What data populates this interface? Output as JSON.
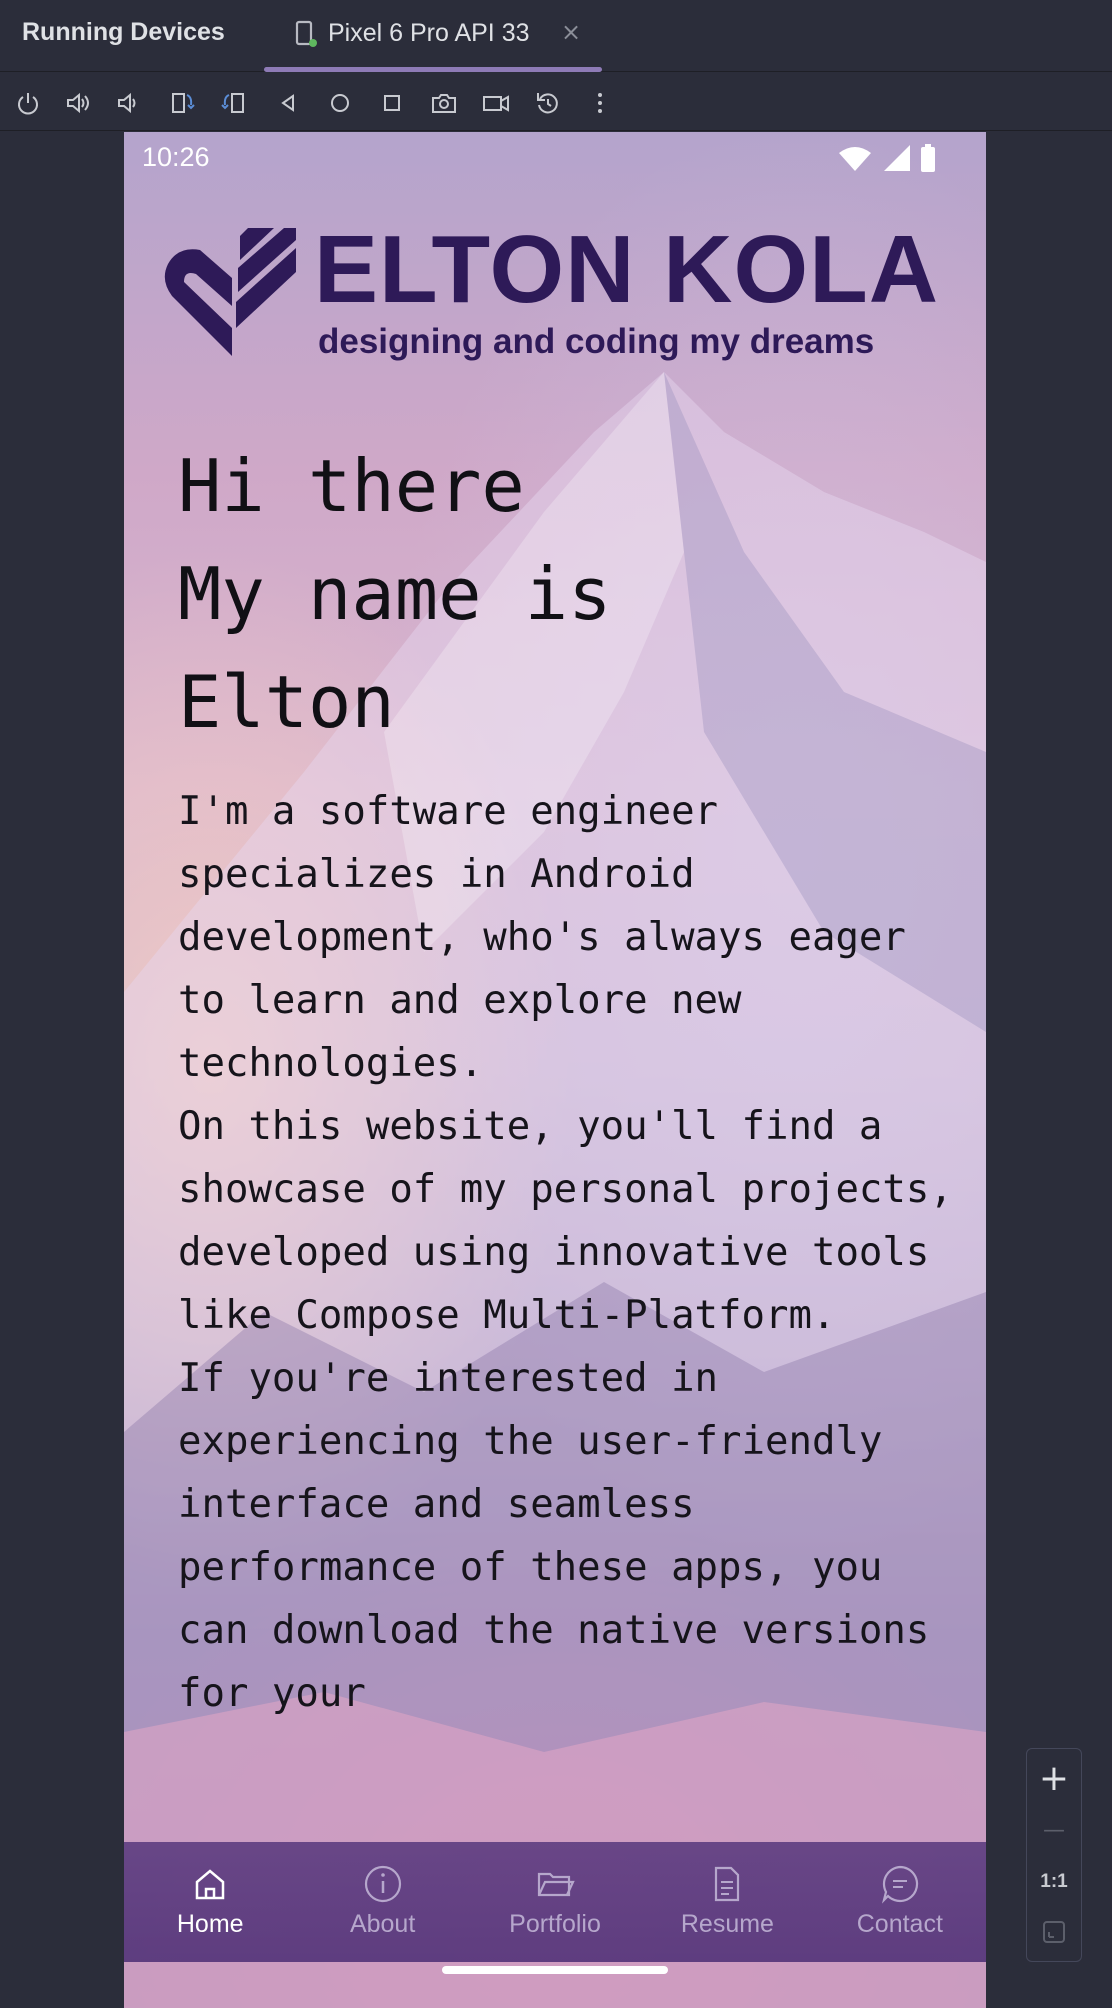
{
  "window": {
    "panel_title": "Running Devices",
    "tab_label": "Pixel 6 Pro API 33",
    "tab_close": "×"
  },
  "toolbar": {
    "buttons": [
      "power-icon",
      "volume-up-icon",
      "volume-down-icon",
      "rotate-left-icon",
      "rotate-right-icon",
      "back-icon",
      "home-icon",
      "overview-icon",
      "screenshot-icon",
      "screen-record-icon",
      "reset-icon",
      "more-icon"
    ]
  },
  "device": {
    "status_time": "10:26",
    "logo": {
      "name": "ELTON KOLA",
      "tagline": "designing and coding my dreams",
      "color": "#2e1a58"
    },
    "hero_lines": [
      "Hi there",
      "My name is",
      "Elton"
    ],
    "intro_paragraphs": [
      "I'm a software engineer specializes in Android development, who's always eager to learn and explore new technologies.",
      "On this website, you'll find a showcase of my personal projects, developed using innovative tools like Compose Multi-Platform.",
      "If you're interested in experiencing the user-friendly interface and seamless performance of these apps, you can download the native versions for your"
    ],
    "bottom_nav": [
      {
        "label": "Home",
        "icon": "home-icon",
        "active": true
      },
      {
        "label": "About",
        "icon": "info-icon",
        "active": false
      },
      {
        "label": "Portfolio",
        "icon": "folder-icon",
        "active": false
      },
      {
        "label": "Resume",
        "icon": "document-icon",
        "active": false
      },
      {
        "label": "Contact",
        "icon": "chat-icon",
        "active": false
      }
    ]
  },
  "zoom": {
    "zoom_in": "+",
    "zoom_out": "—",
    "actual_size": "1:1"
  }
}
